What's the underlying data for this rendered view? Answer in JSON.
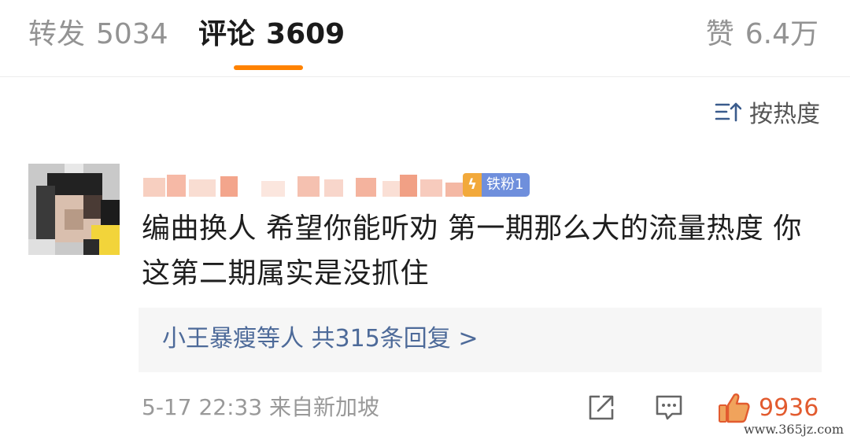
{
  "tabs": {
    "repost": {
      "label": "转发",
      "count": "5034"
    },
    "comments": {
      "label": "评论",
      "count": "3609"
    },
    "likes": {
      "label": "赞",
      "count": "6.4万"
    }
  },
  "sort": {
    "label": "按热度",
    "icon": "sort-icon"
  },
  "comment": {
    "badge": {
      "label": "铁粉1",
      "icon": "lightning-icon"
    },
    "text": "编曲换人 希望你能听劝 第一期那么大的流量热度 你这第二期属实是没抓住",
    "replies": {
      "summary": "小王暴瘦等人 共315条回复 >"
    },
    "meta": {
      "time": "5-17 22:33",
      "source": "来自新加坡"
    },
    "likes": "9936"
  },
  "watermark": "www.365jz.com",
  "colors": {
    "accent": "#ff8200",
    "link": "#4d6a99",
    "like": "#e25b2f",
    "badge": "#6f8fdc"
  }
}
